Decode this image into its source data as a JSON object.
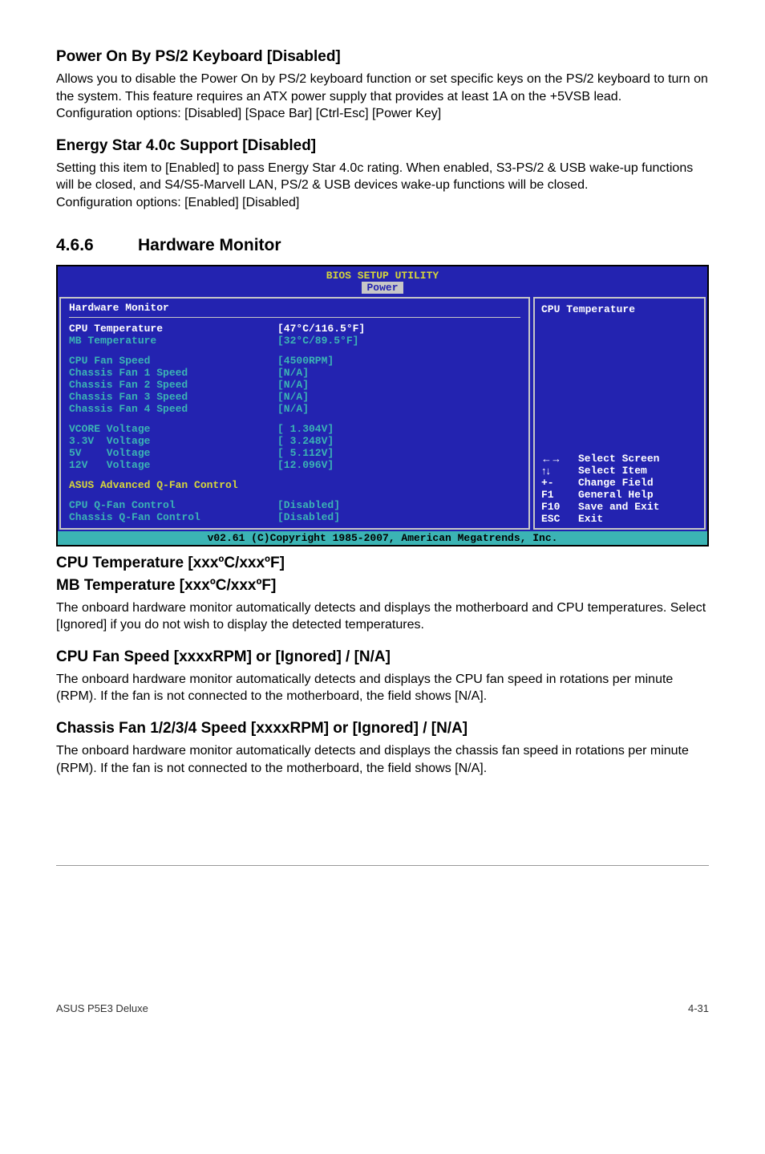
{
  "s1": {
    "title": "Power On By PS/2 Keyboard [Disabled]",
    "body": "Allows you to disable the Power On by PS/2 keyboard function or set specific keys on the PS/2 keyboard to turn on the system. This feature requires an ATX power supply that provides at least 1A on the +5VSB lead.\nConfiguration options: [Disabled] [Space Bar] [Ctrl-Esc] [Power Key]"
  },
  "s2": {
    "title": "Energy Star 4.0c Support [Disabled]",
    "body": "Setting this item to [Enabled] to pass Energy Star 4.0c rating. When enabled, S3-PS/2 & USB wake-up functions will be closed, and S4/S5-Marvell LAN, PS/2 & USB devices wake-up functions will be closed.\nConfiguration options: [Enabled] [Disabled]"
  },
  "hmon": {
    "num": "4.6.6",
    "title": "Hardware Monitor"
  },
  "bios": {
    "utility": "BIOS SETUP UTILITY",
    "tab": "Power",
    "header": "Hardware Monitor",
    "righttop": "CPU Temperature",
    "rows1": [
      {
        "k": "CPU Temperature",
        "v": "[47°C/116.5°F]"
      },
      {
        "k": "MB Temperature",
        "v": "[32°C/89.5°F]"
      }
    ],
    "rows2": [
      {
        "k": "CPU Fan Speed",
        "v": "[4500RPM]"
      },
      {
        "k": "Chassis Fan 1 Speed",
        "v": "[N/A]"
      },
      {
        "k": "Chassis Fan 2 Speed",
        "v": "[N/A]"
      },
      {
        "k": "Chassis Fan 3 Speed",
        "v": "[N/A]"
      },
      {
        "k": "Chassis Fan 4 Speed",
        "v": "[N/A]"
      }
    ],
    "rows3": [
      {
        "k": "VCORE Voltage",
        "v": "[ 1.304V]"
      },
      {
        "k": "3.3V  Voltage",
        "v": "[ 3.248V]"
      },
      {
        "k": "5V    Voltage",
        "v": "[ 5.112V]"
      },
      {
        "k": "12V   Voltage",
        "v": "[12.096V]"
      }
    ],
    "qfan": "ASUS Advanced Q-Fan Control",
    "rows4": [
      {
        "k": "CPU Q-Fan Control",
        "v": "[Disabled]"
      },
      {
        "k": "Chassis Q-Fan Control",
        "v": "[Disabled]"
      }
    ],
    "help": [
      {
        "k": "←→",
        "v": "Select Screen"
      },
      {
        "k": "↑↓",
        "v": "Select Item"
      },
      {
        "k": "+-",
        "v": "Change Field"
      },
      {
        "k": "F1",
        "v": "General Help"
      },
      {
        "k": "F10",
        "v": "Save and Exit"
      },
      {
        "k": "ESC",
        "v": "Exit"
      }
    ],
    "copyright": "v02.61 (C)Copyright 1985-2007, American Megatrends, Inc."
  },
  "s3": {
    "title1": "CPU Temperature [xxxºC/xxxºF]",
    "title2": "MB Temperature [xxxºC/xxxºF]",
    "body": "The onboard hardware monitor automatically detects and displays the motherboard and CPU temperatures. Select [Ignored] if you do not wish to display the detected temperatures."
  },
  "s4": {
    "title": "CPU Fan Speed [xxxxRPM] or [Ignored] / [N/A]",
    "body": "The onboard hardware monitor automatically detects and displays the CPU fan speed in rotations per minute (RPM). If the fan is not connected to the motherboard, the field shows [N/A]."
  },
  "s5": {
    "title": "Chassis Fan 1/2/3/4 Speed [xxxxRPM] or [Ignored] / [N/A]",
    "body": "The onboard hardware monitor automatically detects and displays the chassis fan speed in rotations per minute (RPM). If the fan is not connected to the motherboard, the field shows [N/A]."
  },
  "footer": {
    "left": "ASUS P5E3 Deluxe",
    "right": "4-31"
  }
}
